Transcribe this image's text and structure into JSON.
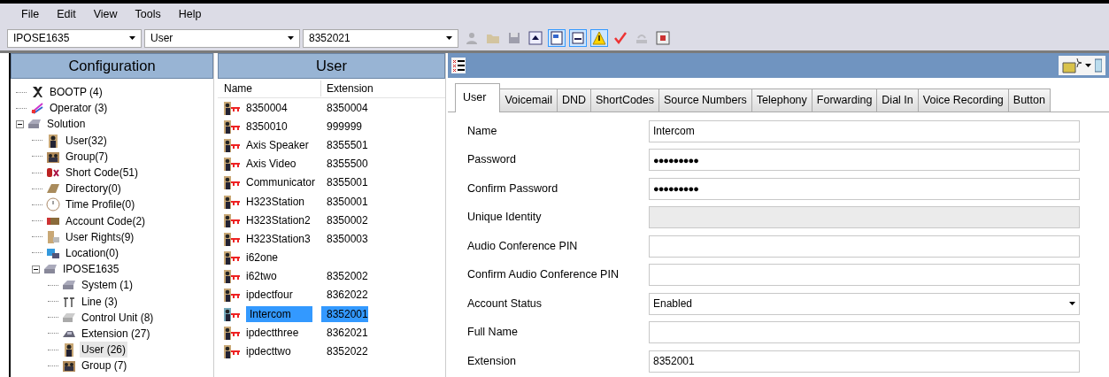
{
  "menu": [
    "File",
    "Edit",
    "View",
    "Tools",
    "Help"
  ],
  "toolbar": {
    "selectors": [
      {
        "value": "IPOSE1635"
      },
      {
        "value": "User"
      },
      {
        "value": "8352021"
      }
    ],
    "tools": [
      {
        "kind": "user",
        "disabled": true
      },
      {
        "kind": "open",
        "disabled": true
      },
      {
        "kind": "save",
        "disabled": true
      },
      {
        "kind": "up",
        "disabled": false,
        "on": false
      },
      {
        "kind": "panel",
        "disabled": false,
        "on": true
      },
      {
        "kind": "list",
        "disabled": false,
        "on": true
      },
      {
        "kind": "warning",
        "disabled": false,
        "on": true
      },
      {
        "kind": "check",
        "disabled": false,
        "on": false
      },
      {
        "kind": "phone",
        "disabled": true
      },
      {
        "kind": "close",
        "disabled": false,
        "on": false
      }
    ]
  },
  "configuration": {
    "title": "Configuration",
    "tree": [
      {
        "label": "BOOTP (4)",
        "kind": "bootp",
        "selected": false
      },
      {
        "label": "Operator (3)",
        "kind": "operator",
        "selected": false
      },
      {
        "label": "Solution",
        "kind": "system",
        "selected": false,
        "expanded": true,
        "children": [
          {
            "label": "User(32)",
            "kind": "user",
            "selected": false
          },
          {
            "label": "Group(7)",
            "kind": "group",
            "selected": false
          },
          {
            "label": "Short Code(51)",
            "kind": "shortcode",
            "selected": false
          },
          {
            "label": "Directory(0)",
            "kind": "directory",
            "selected": false
          },
          {
            "label": "Time Profile(0)",
            "kind": "timeprofile",
            "selected": false
          },
          {
            "label": "Account Code(2)",
            "kind": "account",
            "selected": false
          },
          {
            "label": "User Rights(9)",
            "kind": "rights",
            "selected": false
          },
          {
            "label": "Location(0)",
            "kind": "location",
            "selected": false
          },
          {
            "label": "IPOSE1635",
            "kind": "system",
            "selected": false,
            "expanded": true,
            "children": [
              {
                "label": "System (1)",
                "kind": "system",
                "selected": false
              },
              {
                "label": "Line (3)",
                "kind": "line",
                "selected": false
              },
              {
                "label": "Control Unit (8)",
                "kind": "unit",
                "selected": false
              },
              {
                "label": "Extension (27)",
                "kind": "extension",
                "selected": false
              },
              {
                "label": "User (26)",
                "kind": "user",
                "selected": true
              },
              {
                "label": "Group (7)",
                "kind": "group",
                "selected": false
              }
            ]
          }
        ]
      }
    ]
  },
  "user_list": {
    "title": "User",
    "columns": [
      "Name",
      "Extension"
    ],
    "rows": [
      {
        "name": "8350004",
        "extension": "8350004",
        "selected": false
      },
      {
        "name": "8350010",
        "extension": "999999",
        "selected": false
      },
      {
        "name": "Axis Speaker",
        "extension": "8355501",
        "selected": false
      },
      {
        "name": "Axis Video",
        "extension": "8355500",
        "selected": false
      },
      {
        "name": "Communicator",
        "extension": "8355001",
        "selected": false
      },
      {
        "name": "H323Station",
        "extension": "8350001",
        "selected": false
      },
      {
        "name": "H323Station2",
        "extension": "8350002",
        "selected": false
      },
      {
        "name": "H323Station3",
        "extension": "8350003",
        "selected": false
      },
      {
        "name": "i62one",
        "selected": false
      },
      {
        "name": "i62two",
        "extension": "8352002",
        "selected": false
      },
      {
        "name": "ipdectfour",
        "extension": "8362022",
        "selected": false
      },
      {
        "name": "Intercom",
        "extension": "8352001",
        "selected": true
      },
      {
        "name": "ipdectthree",
        "extension": "8362021",
        "selected": false
      },
      {
        "name": "ipdecttwo",
        "extension": "8352022",
        "selected": false
      }
    ]
  },
  "details": {
    "tabs": [
      {
        "label": "User",
        "selected": true
      },
      {
        "label": "Voicemail",
        "selected": false
      },
      {
        "label": "DND",
        "selected": false
      },
      {
        "label": "ShortCodes",
        "selected": false
      },
      {
        "label": "Source Numbers",
        "selected": false
      },
      {
        "label": "Telephony",
        "selected": false
      },
      {
        "label": "Forwarding",
        "selected": false
      },
      {
        "label": "Dial In",
        "selected": false
      },
      {
        "label": "Voice Recording",
        "selected": false
      },
      {
        "label": "Button",
        "selected": false
      }
    ],
    "fields": [
      {
        "label": "Name",
        "kind": "text",
        "value": "Intercom"
      },
      {
        "label": "Password",
        "kind": "password",
        "value": "●●●●●●●●●"
      },
      {
        "label": "Confirm Password",
        "kind": "password",
        "value": "●●●●●●●●●"
      },
      {
        "label": "Unique Identity",
        "kind": "text",
        "disabled": true
      },
      {
        "label": "Audio Conference PIN",
        "kind": "text"
      },
      {
        "label": "Confirm Audio Conference PIN",
        "kind": "text"
      },
      {
        "label": "Account Status",
        "kind": "select",
        "value": "Enabled"
      },
      {
        "label": "Full Name",
        "kind": "text"
      },
      {
        "label": "Extension",
        "kind": "text",
        "value": "8352001"
      }
    ]
  }
}
